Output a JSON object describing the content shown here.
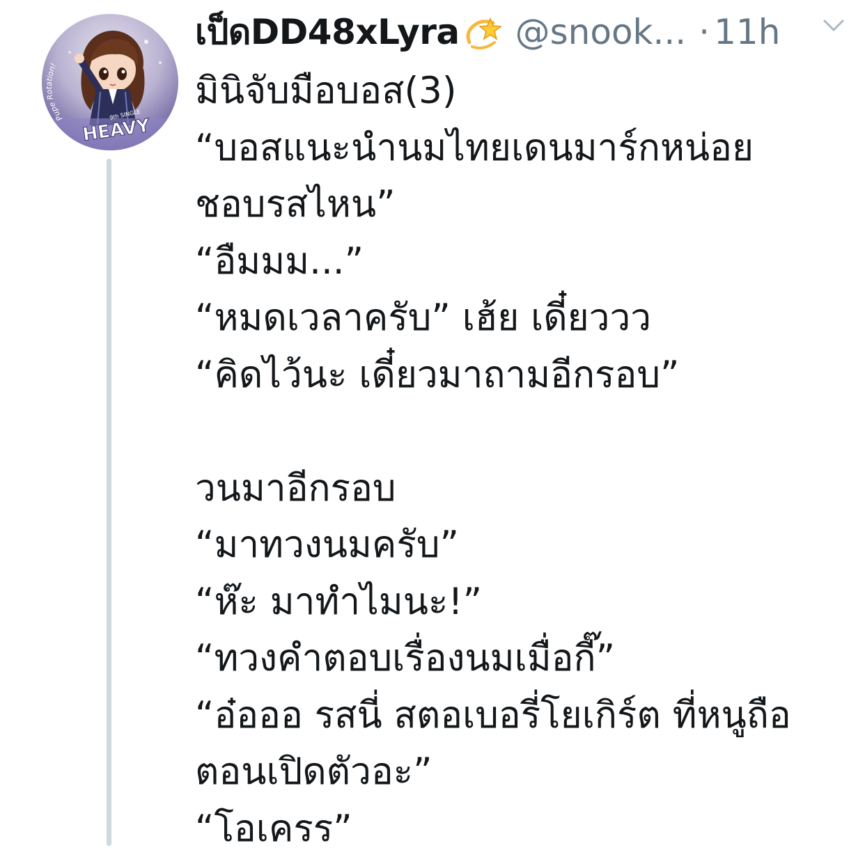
{
  "tweet": {
    "display_name": "เป็ดDD48xLyra",
    "name_emoji": "dizzy-star-emoji",
    "handle": "@snook...",
    "separator": "·",
    "time": "11h",
    "menu_icon": "chevron-down-icon",
    "avatar_text": {
      "circle_text": "Pupe Rotation!",
      "single_label": "9th SINGLE",
      "title": "HEAVY"
    },
    "lines": [
      "มินิจับมือบอส(3)",
      "“บอสแนะนำนมไทยเดนมาร์กหน่อย",
      "ชอบรสไหน”",
      "“อืมมม...”",
      "“หมดเวลาครับ” เฮ้ย เดี๋ยววว",
      "“คิดไว้นะ เดี๋ยวมาถามอีกรอบ”",
      "",
      "วนมาอีกรอบ",
      "“มาทวงนมครับ”",
      "“ห๊ะ มาทำไมนะ!”",
      "“ทวงคำตอบเรื่องนมเมื่อกี๊”",
      "“อ๋อออ รสนี่ สตอเบอรี่โยเกิร์ต ที่หนูถือ",
      "ตอนเปิดตัวอะ”",
      "“โอเครร”"
    ]
  },
  "colors": {
    "text_primary": "#14171a",
    "text_secondary": "#657786",
    "thread_line": "#cfd9de"
  }
}
